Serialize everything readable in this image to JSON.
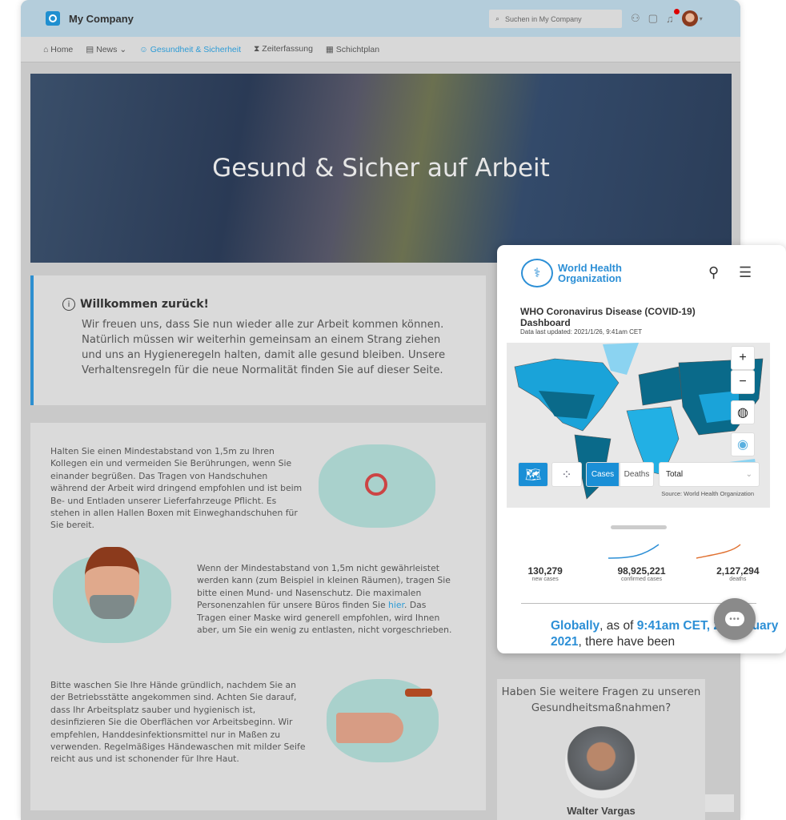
{
  "header": {
    "brand": "My Company",
    "search_placeholder": "Suchen in My Company",
    "notification_count": "1"
  },
  "nav": {
    "items": [
      {
        "label": "Home",
        "icon": "home-icon"
      },
      {
        "label": "News",
        "icon": "news-icon"
      },
      {
        "label": "Gesundheit & Sicherheit",
        "icon": "smile-icon",
        "active": true
      },
      {
        "label": "Zeiterfassung",
        "icon": "hourglass-icon"
      },
      {
        "label": "Schichtplan",
        "icon": "calendar-icon"
      }
    ]
  },
  "hero": {
    "title": "Gesund & Sicher auf Arbeit"
  },
  "welcome": {
    "title": "Willkommen zurück!",
    "text": "Wir freuen uns, dass Sie nun wieder alle zur Arbeit kommen können. Natürlich müssen wir weiterhin gemeinsam an einem Strang ziehen und uns an Hygieneregeln halten, damit alle gesund bleiben. Unsere Verhaltensregeln für die neue Normalität finden Sie auf dieser Seite."
  },
  "sections": {
    "distance": "Halten Sie einen Mindestabstand von 1,5m zu Ihren Kollegen ein und vermeiden Sie Berührungen, wenn Sie einander begrüßen. Das Tragen von Handschuhen während der Arbeit wird dringend empfohlen und ist beim Be- und Entladen unserer Lieferfahrzeuge Pflicht. Es stehen in allen Hallen Boxen mit Einweghandschuhen für Sie bereit.",
    "mask_before": "Wenn der Mindestabstand von 1,5m nicht gewährleistet werden kann (zum Beispiel in kleinen Räumen), tragen Sie bitte einen Mund- und Nasenschutz. Die maximalen Personenzahlen für unsere Büros finden Sie ",
    "mask_link": "hier",
    "mask_after": ". Das Tragen einer Maske wird generell empfohlen, wird Ihnen aber, um Sie ein wenig zu entlasten, nicht vorgeschrieben.",
    "wash": "Bitte waschen Sie Ihre Hände gründlich, nachdem Sie an der Betriebsstätte angekommen sind. Achten Sie darauf, dass Ihr Arbeitsplatz sauber und hygienisch ist, desinfizieren Sie die Oberflächen vor Arbeitsbeginn. Wir empfehlen, Handdesinfektionsmittel nur in Maßen zu verwenden. Regelmäßiges Händewaschen mit milder Seife reicht aus und ist schonender für Ihre Haut."
  },
  "contact": {
    "question": "Haben Sie weitere Fragen zu unseren Gesundheitsmaßnahmen?",
    "name": "Walter Vargas"
  },
  "who": {
    "org": "World Health Organization",
    "org_line1": "World Health",
    "org_line2": "Organization",
    "title": "WHO Coronavirus Disease (COVID-19) Dashboard",
    "updated": "Data last updated: 2021/1/26, 9:41am CET",
    "zoom_in": "+",
    "zoom_out": "−",
    "tab_cases": "Cases",
    "tab_deaths": "Deaths",
    "select_value": "Total",
    "source": "Source: World Health Organization",
    "stats": [
      {
        "value": "130,279",
        "label": "new cases"
      },
      {
        "value": "98,925,221",
        "label": "confirmed cases",
        "color": "#2c8fd6"
      },
      {
        "value": "2,127,294",
        "label": "deaths",
        "color": "#e07030"
      }
    ],
    "globally": "Globally",
    "as_of": ", as of ",
    "time": "9:41am CET, 26 January 2021",
    "there": ", there have been"
  },
  "colors": {
    "accent": "#2d9bd6",
    "who_blue": "#2c8fd6",
    "header": "#b4cddb"
  }
}
